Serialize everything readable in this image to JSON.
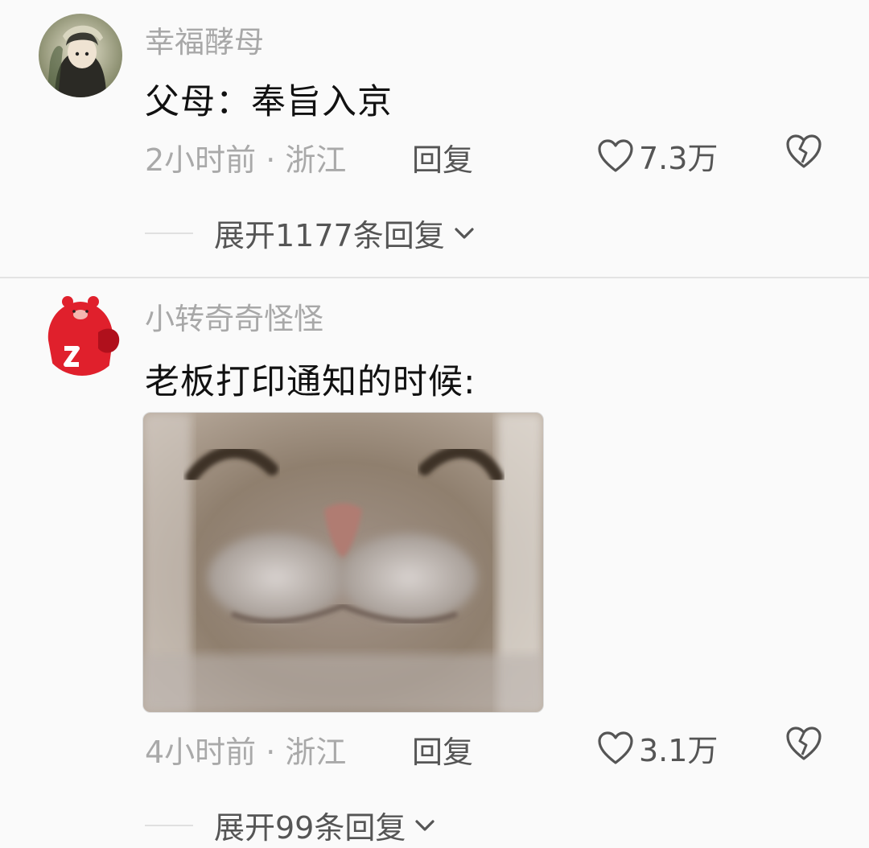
{
  "comments": [
    {
      "username": "幸福酵母",
      "text": "父母：奉旨入京",
      "meta": "2小时前 · 浙江",
      "reply_label": "回复",
      "likes": "7.3万",
      "expand_label": "展开1177条回复"
    },
    {
      "username": "小转奇奇怪怪",
      "text": "老板打印通知的时候:",
      "meta": "4小时前 · 浙江",
      "reply_label": "回复",
      "likes": "3.1万",
      "expand_label": "展开99条回复",
      "attachment": "cat-face-meme-image"
    }
  ],
  "colors": {
    "background": "#fafafa",
    "username": "#a8a8a8",
    "text": "#111111",
    "meta": "#a9a9a9",
    "action": "#555555",
    "avatar2_brand": "#e0202c"
  },
  "icons": [
    "heart-icon",
    "broken-heart-icon",
    "chevron-down-icon"
  ]
}
